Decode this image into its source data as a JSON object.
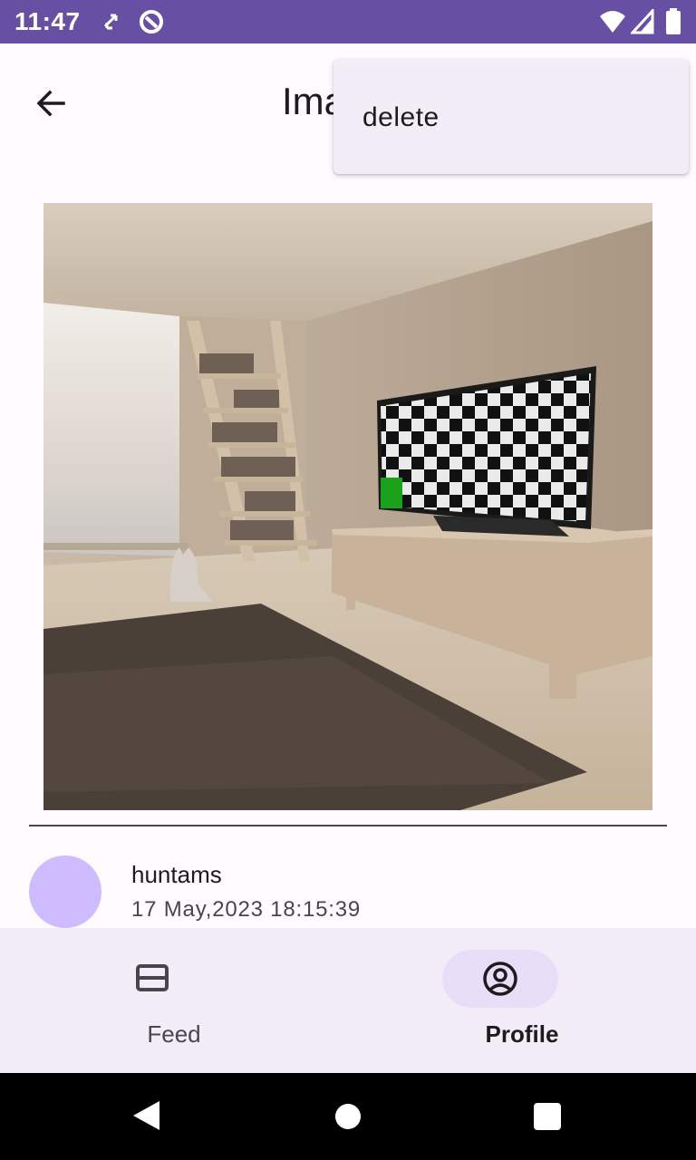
{
  "status_bar": {
    "time": "11:47",
    "icons": [
      "sync-icon",
      "no-disturb-icon",
      "wifi-icon",
      "signal-icon",
      "battery-icon"
    ],
    "background": "#6750a4"
  },
  "app_bar": {
    "title": "Image",
    "back_icon": "arrow-back-icon"
  },
  "menu": {
    "items": [
      {
        "label": "delete"
      }
    ]
  },
  "post": {
    "image": {
      "subject": "interior room with bookshelf ladder, cat, rug and a TV showing a checkerboard"
    },
    "author": {
      "name": "huntams",
      "avatar_color": "#cfbcff"
    },
    "timestamp": "17 May,2023 18:15:39"
  },
  "bottom_nav": {
    "items": [
      {
        "label": "Feed",
        "icon": "feed-card-icon",
        "selected": false
      },
      {
        "label": "Profile",
        "icon": "account-circle-icon",
        "selected": true
      }
    ],
    "indicator_color": "#e8def8"
  },
  "system_nav": {
    "buttons": [
      "back-triangle-icon",
      "home-circle-icon",
      "recents-square-icon"
    ]
  }
}
